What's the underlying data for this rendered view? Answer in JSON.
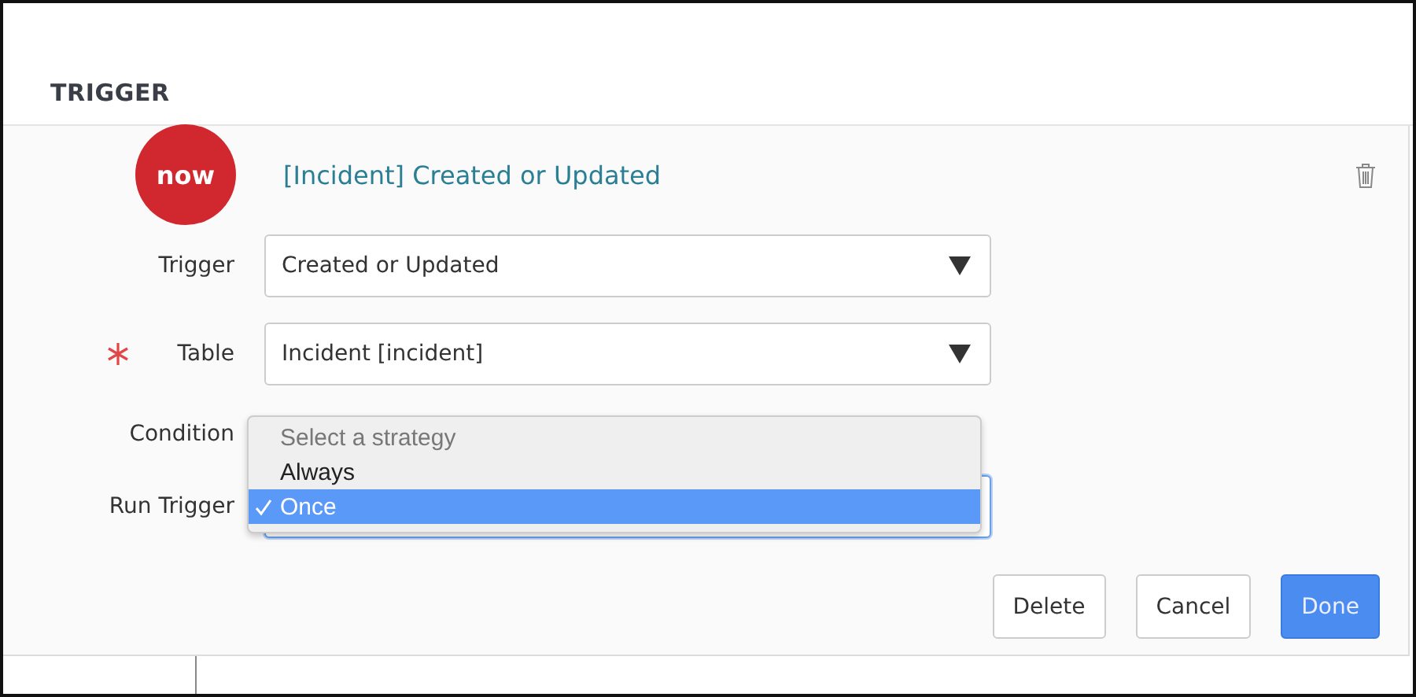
{
  "section": {
    "title": "TRIGGER"
  },
  "trigger": {
    "title": "[Incident] Created or Updated",
    "logo": "now"
  },
  "fields": [
    {
      "label": "Trigger",
      "value": "Created or Updated",
      "required": false,
      "kind": "select"
    },
    {
      "label": "Table",
      "value": "Incident [incident]",
      "required": true,
      "kind": "select"
    },
    {
      "label": "Condition",
      "kind": "covered"
    },
    {
      "label": "Run Trigger",
      "kind": "focused"
    }
  ],
  "dropdown": {
    "options": [
      {
        "label": "Select a strategy",
        "selected": false,
        "disabled": true
      },
      {
        "label": "Always",
        "selected": false,
        "disabled": false
      },
      {
        "label": "Once",
        "selected": true,
        "disabled": false
      }
    ]
  },
  "buttons": [
    {
      "label": "Delete",
      "primary": false
    },
    {
      "label": "Cancel",
      "primary": false
    },
    {
      "label": "Done",
      "primary": true
    }
  ]
}
